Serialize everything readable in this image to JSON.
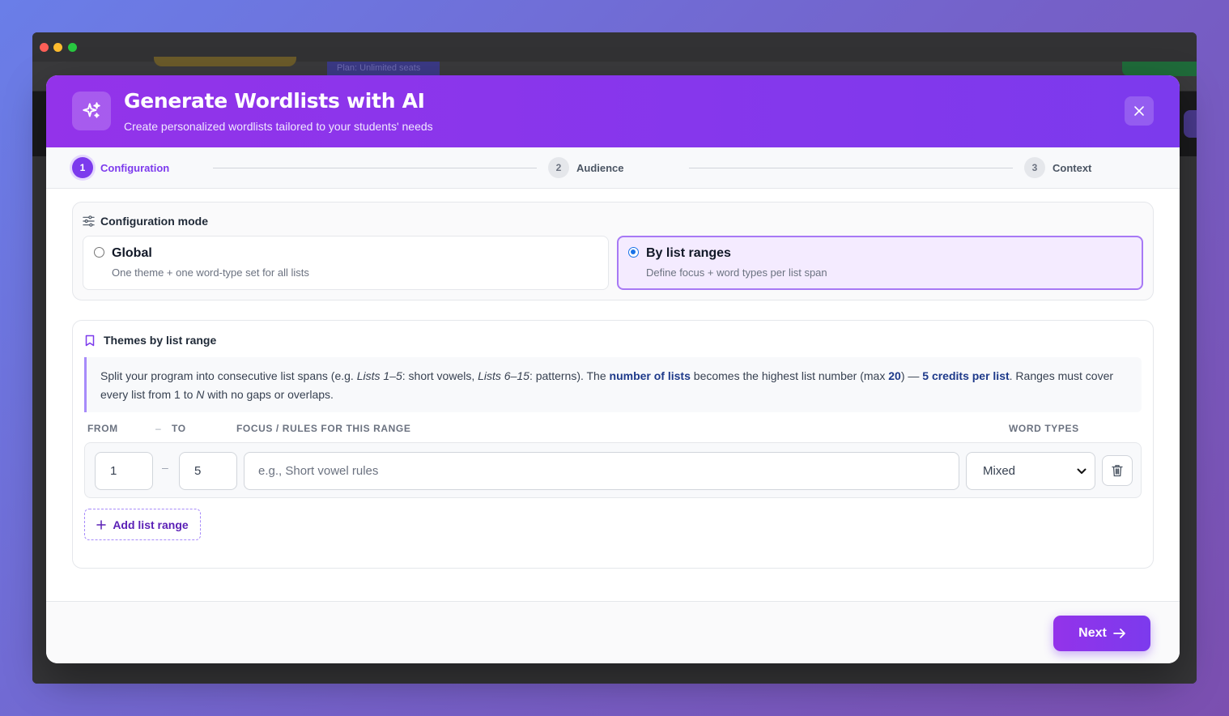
{
  "background_app": {
    "plan_label": "Plan: Unlimited seats"
  },
  "modal": {
    "title": "Generate Wordlists with AI",
    "subtitle": "Create personalized wordlists tailored to your students' needs",
    "accent_color": "#7c3aed",
    "icon": "sparkles-icon"
  },
  "steps": [
    {
      "num": "1",
      "label": "Configuration",
      "state": "active"
    },
    {
      "num": "2",
      "label": "Audience",
      "state": "inactive"
    },
    {
      "num": "3",
      "label": "Context",
      "state": "inactive"
    }
  ],
  "config_mode": {
    "label": "Configuration mode",
    "icon": "sliders-icon",
    "options": [
      {
        "title": "Global",
        "desc": "One theme + one word-type set for all lists",
        "selected": false
      },
      {
        "title": "By list ranges",
        "desc": "Define focus + word types per list span",
        "selected": true
      }
    ]
  },
  "themes": {
    "label": "Themes by list range",
    "icon": "bookmark-icon",
    "info": {
      "p1": "Split your program into consecutive list spans (e.g. ",
      "em1": "Lists 1–5",
      "p2": ": short vowels, ",
      "em2": "Lists 6–15",
      "p3": ": patterns). The ",
      "b1": "number of lists",
      "p4": " becomes the highest list number (max ",
      "b2": "20",
      "p5": ") — ",
      "b3": "5 credits per list",
      "p6": ". Ranges must cover every list from 1 to ",
      "em3": "N",
      "p7": " with no gaps or overlaps."
    },
    "columns": {
      "from": "FROM",
      "dash": "–",
      "to": "TO",
      "focus": "FOCUS / RULES FOR THIS RANGE",
      "word_types": "WORD TYPES"
    },
    "rows": [
      {
        "from": "1",
        "to": "5",
        "focus_value": "",
        "focus_placeholder": "e.g., Short vowel rules",
        "word_type": "Mixed"
      }
    ],
    "row_dash": "–",
    "add_range_label": "Add list range"
  },
  "footer": {
    "next_label": "Next"
  }
}
